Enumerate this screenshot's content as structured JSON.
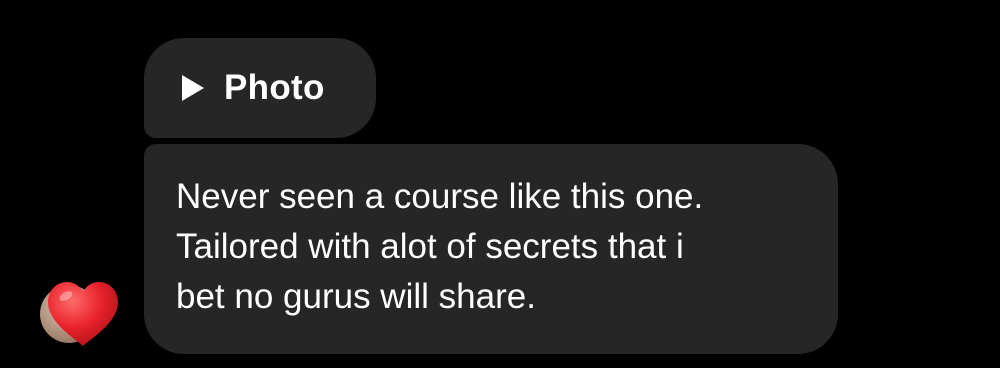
{
  "photo_bubble": {
    "icon": "play-icon",
    "label": "Photo"
  },
  "message": {
    "lines": [
      "Never seen a course like this one.",
      "Tailored with alot of secrets that i",
      "bet no gurus will share."
    ]
  },
  "reaction": {
    "icon": "heart-icon",
    "color": "#e8232b"
  },
  "colors": {
    "background": "#000000",
    "bubble": "#262626",
    "text": "#ffffff"
  }
}
